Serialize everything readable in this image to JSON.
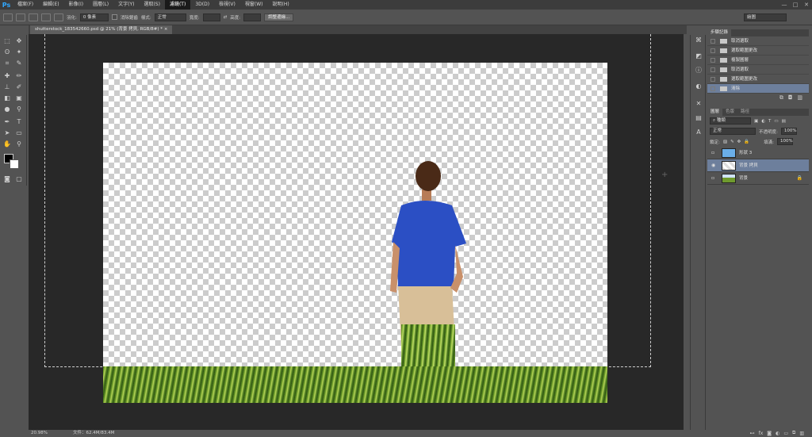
{
  "app": {
    "logo": "Ps"
  },
  "menu": [
    "檔案(F)",
    "編輯(E)",
    "影像(I)",
    "圖層(L)",
    "文字(Y)",
    "選取(S)",
    "濾鏡(T)",
    "3D(D)",
    "檢視(V)",
    "視窗(W)",
    "說明(H)"
  ],
  "window_controls": [
    "—",
    "□",
    "✕"
  ],
  "options": {
    "feather_label": "羽化:",
    "feather_value": "0 像素",
    "antialias_label": "消除鋸齒",
    "style_label": "樣式:",
    "style_value": "正常",
    "width_label": "寬度:",
    "height_label": "高度:",
    "refine_button": "調整邊緣...",
    "workspace": "繪圖"
  },
  "document": {
    "tab_label": "shutterstock_183542660.psd @ 21% (背景 拷貝, RGB/8#) *",
    "tab_close": "×"
  },
  "status": {
    "zoom": "20.98%",
    "doc_size": "文件：62.4M/83.4M"
  },
  "history": {
    "tabs": [
      "步驟記錄"
    ],
    "items": [
      {
        "label": "取消選取",
        "selected": false
      },
      {
        "label": "選取範圍更改",
        "selected": false
      },
      {
        "label": "複製圖層",
        "selected": false
      },
      {
        "label": "取消選取",
        "selected": false
      },
      {
        "label": "選取範圍更改",
        "selected": false
      },
      {
        "label": "清除",
        "selected": true
      }
    ]
  },
  "layers": {
    "tabs": [
      "圖層",
      "色版",
      "路徑"
    ],
    "filter_label": "種類",
    "blend_mode": "正常",
    "opacity_label": "不透明度:",
    "opacity_value": "100%",
    "lock_label": "鎖定:",
    "fill_label": "填滿:",
    "fill_value": "100%",
    "items": [
      {
        "name": "形狀 3",
        "visible": false,
        "selected": false,
        "locked": false
      },
      {
        "name": "背景 拷貝",
        "visible": true,
        "selected": true,
        "locked": false
      },
      {
        "name": "背景",
        "visible": false,
        "selected": false,
        "locked": true
      }
    ]
  },
  "colors": {
    "accent": "#31a8ff",
    "selection": "#6d7f9c",
    "foreground": "#000000",
    "background": "#ffffff",
    "shirt": "#2b4fc4"
  }
}
